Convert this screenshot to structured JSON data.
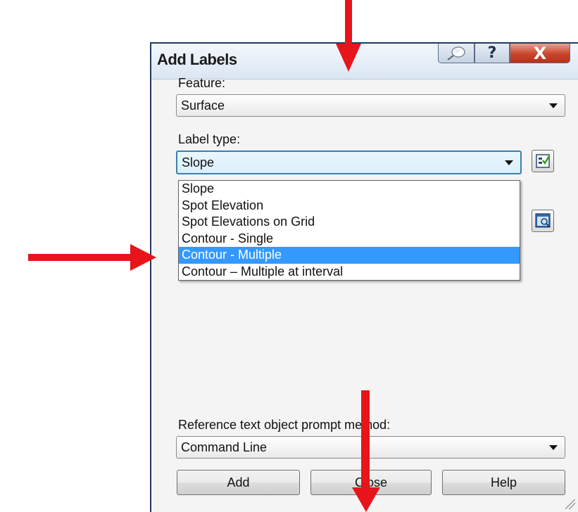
{
  "dialog": {
    "title": "Add Labels",
    "feature_label": "Feature:",
    "feature_value": "Surface",
    "label_type_label": "Label type:",
    "label_type_value": "Slope",
    "label_type_options": [
      "Slope",
      "Spot Elevation",
      "Spot Elevations on Grid",
      "Contour - Single",
      "Contour - Multiple",
      "Contour – Multiple at interval"
    ],
    "highlighted_option": "Contour - Multiple",
    "prompt_method_label": "Reference text object prompt method:",
    "prompt_method_value": "Command Line",
    "buttons": {
      "add": "Add",
      "close": "Close",
      "help": "Help"
    },
    "titlebar": {
      "help_glyph": "?",
      "close_glyph": "X"
    }
  },
  "colors": {
    "annotation_arrow": "#e8141b",
    "selection": "#3399ff",
    "close_button": "#c9452c"
  },
  "icons": [
    "pin-icon",
    "help-icon",
    "close-icon",
    "label-style-icon",
    "preview-icon",
    "resize-grip-icon"
  ]
}
